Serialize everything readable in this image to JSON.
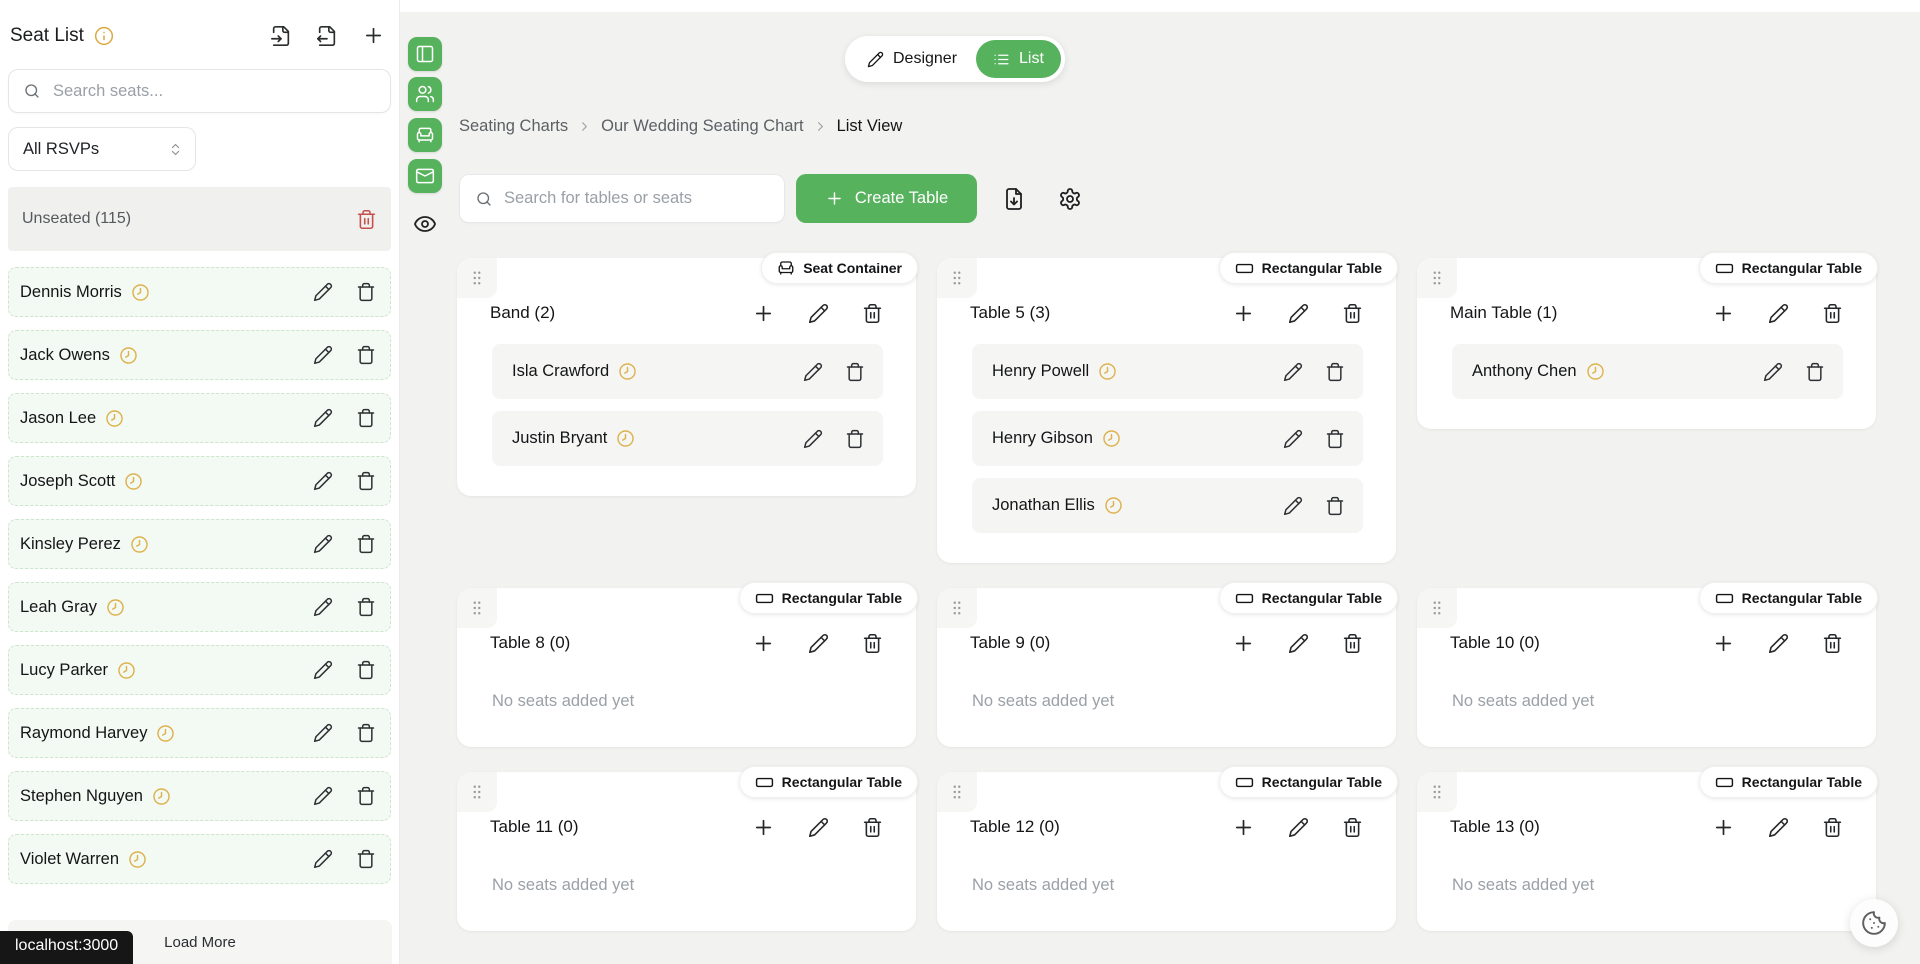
{
  "sidebar": {
    "title": "Seat List",
    "search_placeholder": "Search seats...",
    "rsvp_filter_value": "All RSVPs",
    "unseated_header": "Unseated (115)",
    "guests": [
      "Dennis Morris",
      "Jack Owens",
      "Jason Lee",
      "Joseph Scott",
      "Kinsley Perez",
      "Leah Gray",
      "Lucy Parker",
      "Raymond Harvey",
      "Stephen Nguyen",
      "Violet Warren"
    ],
    "load_more_label": "Load More"
  },
  "status_tooltip": "localhost:3000",
  "view_toggle": {
    "designer_label": "Designer",
    "list_label": "List"
  },
  "breadcrumbs": [
    "Seating Charts",
    "Our Wedding Seating Chart",
    "List View"
  ],
  "toolbar": {
    "search_placeholder": "Search for tables or seats",
    "create_table_label": "Create Table"
  },
  "cards": {
    "empty_text": "No seats added yet"
  },
  "tables": [
    {
      "badge": "Seat Container",
      "badge_icon": "armchair",
      "title": "Band (2)",
      "seats": [
        "Isla Crawford",
        "Justin Bryant"
      ]
    },
    {
      "badge": "Rectangular Table",
      "badge_icon": "rectangle",
      "title": "Table 5 (3)",
      "seats": [
        "Henry Powell",
        "Henry Gibson",
        "Jonathan Ellis"
      ]
    },
    {
      "badge": "Rectangular Table",
      "badge_icon": "rectangle",
      "title": "Main Table (1)",
      "seats": [
        "Anthony Chen"
      ]
    },
    {
      "badge": "Rectangular Table",
      "badge_icon": "rectangle",
      "title": "Table 8 (0)",
      "seats": []
    },
    {
      "badge": "Rectangular Table",
      "badge_icon": "rectangle",
      "title": "Table 9 (0)",
      "seats": []
    },
    {
      "badge": "Rectangular Table",
      "badge_icon": "rectangle",
      "title": "Table 10 (0)",
      "seats": []
    },
    {
      "badge": "Rectangular Table",
      "badge_icon": "rectangle",
      "title": "Table 11 (0)",
      "seats": []
    },
    {
      "badge": "Rectangular Table",
      "badge_icon": "rectangle",
      "title": "Table 12 (0)",
      "seats": []
    },
    {
      "badge": "Rectangular Table",
      "badge_icon": "rectangle",
      "title": "Table 13 (0)",
      "seats": []
    }
  ],
  "colors": {
    "accent_green": "#57b25d",
    "warning_amber": "#d9a93f",
    "danger_red": "#c6504e"
  }
}
